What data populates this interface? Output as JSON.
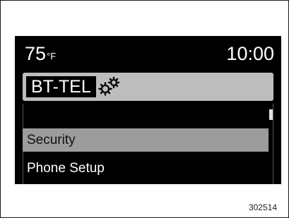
{
  "status_bar": {
    "temperature": "75",
    "temperature_unit": "°F",
    "time": "10:00"
  },
  "header": {
    "mode_label": "BT-TEL",
    "settings_icon": "gears-icon"
  },
  "menu": {
    "items": [
      {
        "label": "Security",
        "selected": true
      },
      {
        "label": "Phone Setup",
        "selected": false
      }
    ]
  },
  "figure_number": "302514"
}
